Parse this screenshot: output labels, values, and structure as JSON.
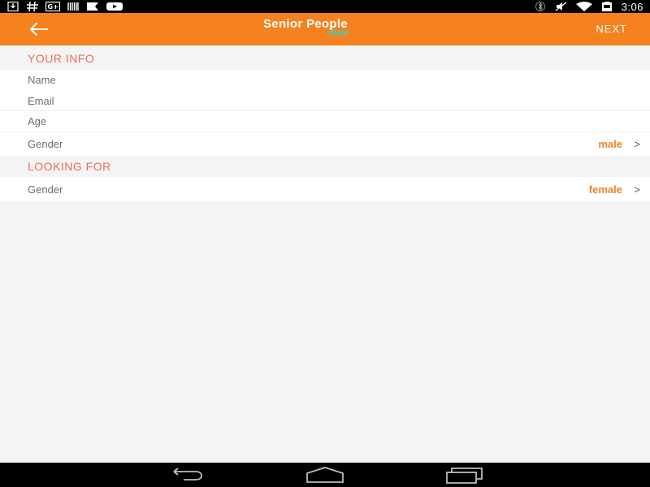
{
  "status_bar": {
    "time": "3:06",
    "icons_left": [
      "download-icon",
      "hash-icon",
      "gplus-icon",
      "barcode-icon",
      "message-icon",
      "youtube-icon"
    ],
    "icons_right": [
      "bluetooth-icon",
      "mute-icon",
      "wifi-icon",
      "battery-icon"
    ]
  },
  "app_bar": {
    "title": "Senior People",
    "subtitle": "Meet",
    "next_label": "NEXT",
    "back_icon": "arrow-left-icon"
  },
  "your_info": {
    "header": "YOUR INFO",
    "name_label": "Name",
    "email_label": "Email",
    "age_label": "Age",
    "gender_label": "Gender",
    "gender_value": "male",
    "chevron": ">"
  },
  "looking_for": {
    "header": "LOOKING FOR",
    "gender_label": "Gender",
    "gender_value": "female",
    "chevron": ">"
  },
  "colors": {
    "accent": "#f5821f",
    "section_header": "#f06a5c",
    "brand_sub": "#3ed0c0"
  }
}
